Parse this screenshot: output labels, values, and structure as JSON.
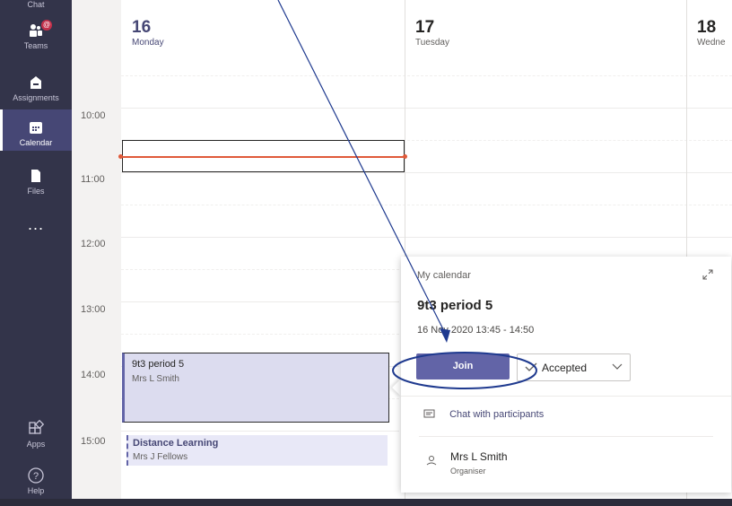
{
  "rail": {
    "items": [
      {
        "label": "Chat",
        "icon": "chat-icon"
      },
      {
        "label": "Teams",
        "icon": "teams-icon",
        "badge": "@"
      },
      {
        "label": "Assignments",
        "icon": "assignments-icon"
      },
      {
        "label": "Calendar",
        "icon": "calendar-icon",
        "active": true
      },
      {
        "label": "Files",
        "icon": "files-icon"
      },
      {
        "label": "...",
        "icon": "more-icon"
      },
      {
        "label": "Apps",
        "icon": "apps-icon"
      },
      {
        "label": "Help",
        "icon": "help-icon"
      }
    ]
  },
  "calendar": {
    "days": [
      {
        "num": "16",
        "name": "Monday"
      },
      {
        "num": "17",
        "name": "Tuesday"
      },
      {
        "num": "18",
        "name": "Wedne"
      }
    ],
    "times": [
      "10:00",
      "11:00",
      "12:00",
      "13:00",
      "14:00",
      "15:00"
    ],
    "events": {
      "selected": {
        "title": "9t3 period 5",
        "organizer": "Mrs L Smith"
      },
      "distance": {
        "title": "Distance Learning",
        "organizer": "Mrs J Fellows"
      }
    }
  },
  "popup": {
    "calendar_label": "My calendar",
    "title": "9t3 period 5",
    "when": "16 Nov 2020 13:45 - 14:50",
    "join_label": "Join",
    "accepted_label": "Accepted",
    "chat_label": "Chat with participants",
    "organizer_name": "Mrs L Smith",
    "organizer_role": "Organiser"
  },
  "colors": {
    "rail": "#33344a",
    "accent": "#6264a7",
    "now_line": "#e05a3a",
    "annotation": "#1f3a8f"
  }
}
